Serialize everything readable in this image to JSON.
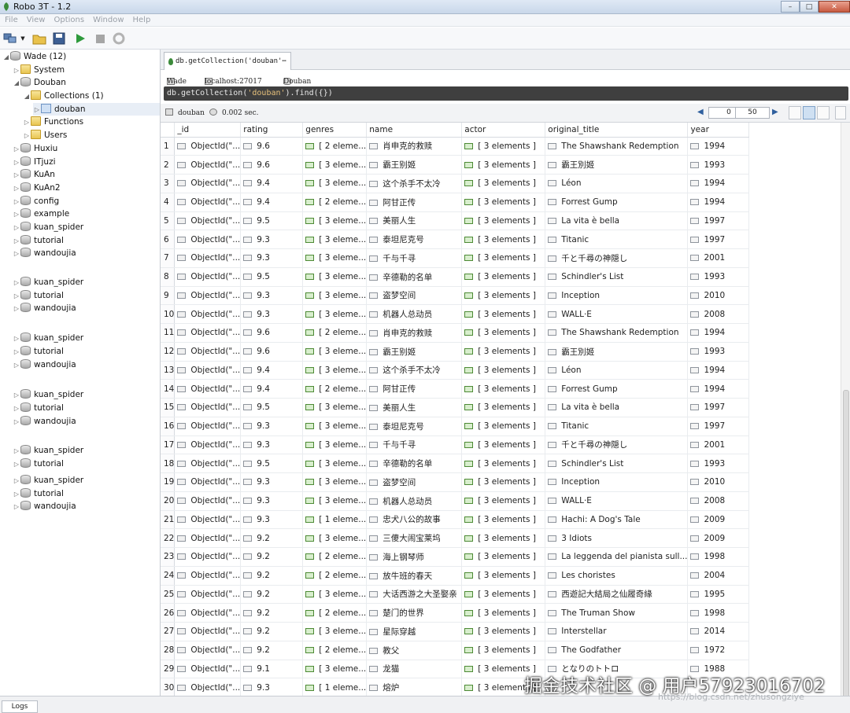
{
  "window": {
    "title": "Robo 3T - 1.2"
  },
  "menu": [
    "File",
    "View",
    "Options",
    "Window",
    "Help"
  ],
  "tree": [
    {
      "label": "Wade (12)",
      "level": 0,
      "type": "db",
      "expanded": true
    },
    {
      "label": "System",
      "level": 1,
      "type": "folder"
    },
    {
      "label": "Douban",
      "level": 1,
      "type": "db",
      "expanded": true
    },
    {
      "label": "Collections (1)",
      "level": 2,
      "type": "folder",
      "expanded": true
    },
    {
      "label": "douban",
      "level": 3,
      "type": "collection",
      "selected": true
    },
    {
      "label": "Functions",
      "level": 2,
      "type": "folder"
    },
    {
      "label": "Users",
      "level": 2,
      "type": "folder"
    },
    {
      "label": "Huxiu",
      "level": 1,
      "type": "db"
    },
    {
      "label": "ITjuzi",
      "level": 1,
      "type": "db"
    },
    {
      "label": "KuAn",
      "level": 1,
      "type": "db"
    },
    {
      "label": "KuAn2",
      "level": 1,
      "type": "db"
    },
    {
      "label": "config",
      "level": 1,
      "type": "db"
    },
    {
      "label": "example",
      "level": 1,
      "type": "db"
    },
    {
      "label": "kuan_spider",
      "level": 1,
      "type": "db"
    },
    {
      "label": "tutorial",
      "level": 1,
      "type": "db"
    },
    {
      "label": "wandoujia",
      "level": 1,
      "type": "db"
    },
    {
      "label": "kuan_spider",
      "level": 1,
      "type": "db"
    },
    {
      "label": "tutorial",
      "level": 1,
      "type": "db"
    },
    {
      "label": "wandoujia",
      "level": 1,
      "type": "db"
    },
    {
      "label": "kuan_spider",
      "level": 1,
      "type": "db"
    },
    {
      "label": "tutorial",
      "level": 1,
      "type": "db"
    },
    {
      "label": "wandoujia",
      "level": 1,
      "type": "db"
    },
    {
      "label": "kuan_spider",
      "level": 1,
      "type": "db"
    },
    {
      "label": "tutorial",
      "level": 1,
      "type": "db"
    },
    {
      "label": "wandoujia",
      "level": 1,
      "type": "db"
    },
    {
      "label": "kuan_spider",
      "level": 1,
      "type": "db"
    },
    {
      "label": "tutorial",
      "level": 1,
      "type": "db"
    },
    {
      "label": "kuan_spider",
      "level": 1,
      "type": "db"
    },
    {
      "label": "tutorial",
      "level": 1,
      "type": "db"
    },
    {
      "label": "wandoujia",
      "level": 1,
      "type": "db"
    }
  ],
  "tab": {
    "label": "db.getCollection('douban'⋯"
  },
  "info": {
    "server": "Wade",
    "host": "localhost:27017",
    "database": "Douban"
  },
  "query": {
    "prefix": "db.getCollection(",
    "arg": "'douban'",
    "suffix": ").find({})"
  },
  "results": {
    "collection": "douban",
    "time": "0.002 sec.",
    "skip": "0",
    "limit": "50"
  },
  "columns": [
    "_id",
    "rating",
    "genres",
    "name",
    "actor",
    "original_title",
    "year"
  ],
  "rows": [
    [
      "ObjectId(\"...",
      "9.6",
      "[ 2 eleme...",
      "肖申克的救赎",
      "[ 3 elements ]",
      "The Shawshank Redemption",
      "1994"
    ],
    [
      "ObjectId(\"...",
      "9.6",
      "[ 3 eleme...",
      "霸王别姬",
      "[ 3 elements ]",
      "霸王別姬",
      "1993"
    ],
    [
      "ObjectId(\"...",
      "9.4",
      "[ 3 eleme...",
      "这个杀手不太冷",
      "[ 3 elements ]",
      "Léon",
      "1994"
    ],
    [
      "ObjectId(\"...",
      "9.4",
      "[ 2 eleme...",
      "阿甘正传",
      "[ 3 elements ]",
      "Forrest Gump",
      "1994"
    ],
    [
      "ObjectId(\"...",
      "9.5",
      "[ 3 eleme...",
      "美丽人生",
      "[ 3 elements ]",
      "La vita è bella",
      "1997"
    ],
    [
      "ObjectId(\"...",
      "9.3",
      "[ 3 eleme...",
      "泰坦尼克号",
      "[ 3 elements ]",
      "Titanic",
      "1997"
    ],
    [
      "ObjectId(\"...",
      "9.3",
      "[ 3 eleme...",
      "千与千寻",
      "[ 3 elements ]",
      "千と千尋の神隠し",
      "2001"
    ],
    [
      "ObjectId(\"...",
      "9.5",
      "[ 3 eleme...",
      "辛德勒的名单",
      "[ 3 elements ]",
      "Schindler's List",
      "1993"
    ],
    [
      "ObjectId(\"...",
      "9.3",
      "[ 3 eleme...",
      "盗梦空间",
      "[ 3 elements ]",
      "Inception",
      "2010"
    ],
    [
      "ObjectId(\"...",
      "9.3",
      "[ 3 eleme...",
      "机器人总动员",
      "[ 3 elements ]",
      "WALL·E",
      "2008"
    ],
    [
      "ObjectId(\"...",
      "9.6",
      "[ 2 eleme...",
      "肖申克的救赎",
      "[ 3 elements ]",
      "The Shawshank Redemption",
      "1994"
    ],
    [
      "ObjectId(\"...",
      "9.6",
      "[ 3 eleme...",
      "霸王别姬",
      "[ 3 elements ]",
      "霸王別姬",
      "1993"
    ],
    [
      "ObjectId(\"...",
      "9.4",
      "[ 3 eleme...",
      "这个杀手不太冷",
      "[ 3 elements ]",
      "Léon",
      "1994"
    ],
    [
      "ObjectId(\"...",
      "9.4",
      "[ 2 eleme...",
      "阿甘正传",
      "[ 3 elements ]",
      "Forrest Gump",
      "1994"
    ],
    [
      "ObjectId(\"...",
      "9.5",
      "[ 3 eleme...",
      "美丽人生",
      "[ 3 elements ]",
      "La vita è bella",
      "1997"
    ],
    [
      "ObjectId(\"...",
      "9.3",
      "[ 3 eleme...",
      "泰坦尼克号",
      "[ 3 elements ]",
      "Titanic",
      "1997"
    ],
    [
      "ObjectId(\"...",
      "9.3",
      "[ 3 eleme...",
      "千与千寻",
      "[ 3 elements ]",
      "千と千尋の神隠し",
      "2001"
    ],
    [
      "ObjectId(\"...",
      "9.5",
      "[ 3 eleme...",
      "辛德勒的名单",
      "[ 3 elements ]",
      "Schindler's List",
      "1993"
    ],
    [
      "ObjectId(\"...",
      "9.3",
      "[ 3 eleme...",
      "盗梦空间",
      "[ 3 elements ]",
      "Inception",
      "2010"
    ],
    [
      "ObjectId(\"...",
      "9.3",
      "[ 3 eleme...",
      "机器人总动员",
      "[ 3 elements ]",
      "WALL·E",
      "2008"
    ],
    [
      "ObjectId(\"...",
      "9.3",
      "[ 1 eleme...",
      "忠犬八公的故事",
      "[ 3 elements ]",
      "Hachi: A Dog's Tale",
      "2009"
    ],
    [
      "ObjectId(\"...",
      "9.2",
      "[ 3 eleme...",
      "三傻大闹宝莱坞",
      "[ 3 elements ]",
      "3 Idiots",
      "2009"
    ],
    [
      "ObjectId(\"...",
      "9.2",
      "[ 2 eleme...",
      "海上钢琴师",
      "[ 3 elements ]",
      "La leggenda del pianista sull...",
      "1998"
    ],
    [
      "ObjectId(\"...",
      "9.2",
      "[ 2 eleme...",
      "放牛班的春天",
      "[ 3 elements ]",
      "Les choristes",
      "2004"
    ],
    [
      "ObjectId(\"...",
      "9.2",
      "[ 3 eleme...",
      "大话西游之大圣娶亲",
      "[ 3 elements ]",
      "西遊記大結局之仙履奇緣",
      "1995"
    ],
    [
      "ObjectId(\"...",
      "9.2",
      "[ 2 eleme...",
      "楚门的世界",
      "[ 3 elements ]",
      "The Truman Show",
      "1998"
    ],
    [
      "ObjectId(\"...",
      "9.2",
      "[ 3 eleme...",
      "星际穿越",
      "[ 3 elements ]",
      "Interstellar",
      "2014"
    ],
    [
      "ObjectId(\"...",
      "9.2",
      "[ 2 eleme...",
      "教父",
      "[ 3 elements ]",
      "The Godfather",
      "1972"
    ],
    [
      "ObjectId(\"...",
      "9.1",
      "[ 3 eleme...",
      "龙猫",
      "[ 3 elements ]",
      "となりのトトロ",
      "1988"
    ],
    [
      "ObjectId(\"...",
      "9.3",
      "[ 1 eleme...",
      "熔炉",
      "[ 3 elements ]",
      "",
      ""
    ]
  ],
  "bottom": {
    "logs_label": "Logs"
  },
  "watermark": {
    "text": "掘金技术社区 @ 用户57923016702",
    "sub": "https://blog.csdn.net/zhusongziye"
  }
}
